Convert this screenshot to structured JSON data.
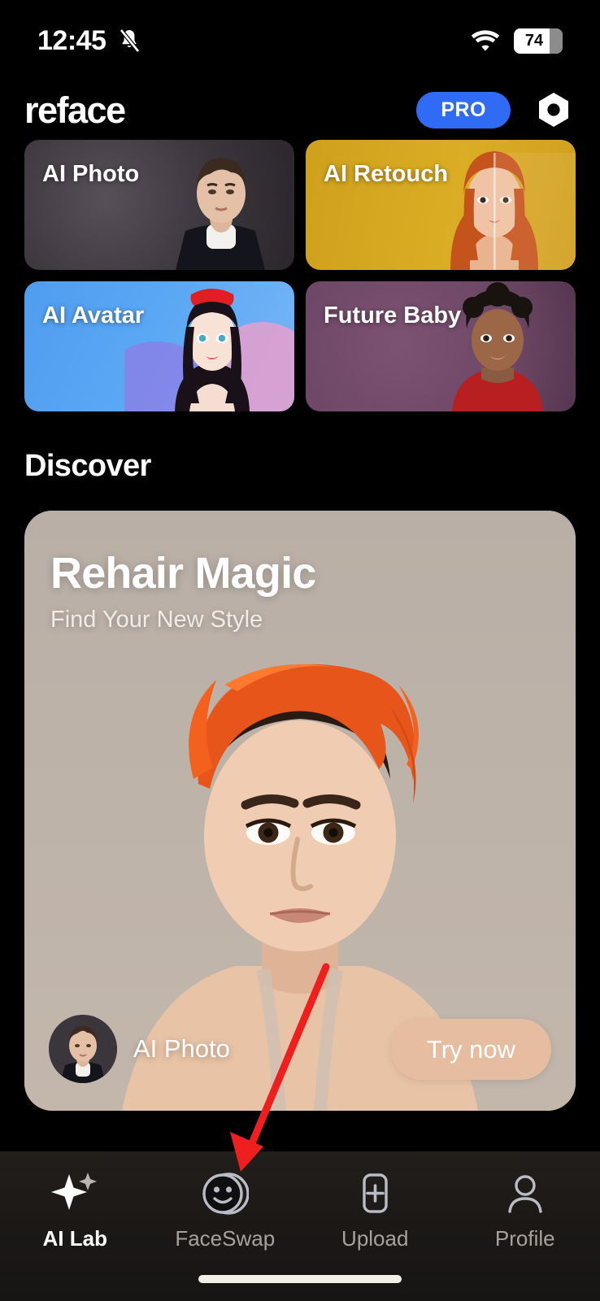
{
  "status_bar": {
    "time": "12:45",
    "bell_icon": "bell-muted-icon",
    "wifi_icon": "wifi-icon",
    "battery_level": "74",
    "battery_percent": 74
  },
  "header": {
    "logo": "reface",
    "pro_label": "PRO",
    "settings_icon": "hexagon-settings-icon"
  },
  "feature_cards": [
    {
      "label": "AI Photo",
      "color": "#3b353c",
      "name": "card-ai-photo"
    },
    {
      "label": "AI Retouch",
      "color": "#d4a820",
      "name": "card-ai-retouch"
    },
    {
      "label": "AI Avatar",
      "color": "#4f9df0",
      "name": "card-ai-avatar"
    },
    {
      "label": "Future Baby",
      "color": "#6d4765",
      "name": "card-future-baby"
    }
  ],
  "discover": {
    "heading": "Discover",
    "featured": {
      "title": "Rehair Magic",
      "subtitle": "Find Your New Style",
      "author": "AI Photo",
      "cta_label": "Try now",
      "cta_color": "#e7bda2",
      "card_color": "#b7ada3"
    }
  },
  "bottom_nav": {
    "items": [
      {
        "label": "AI Lab",
        "icon": "sparkle-icon",
        "active": true
      },
      {
        "label": "FaceSwap",
        "icon": "smiley-face-icon",
        "active": false
      },
      {
        "label": "Upload",
        "icon": "plus-square-icon",
        "active": false
      },
      {
        "label": "Profile",
        "icon": "person-icon",
        "active": false
      }
    ]
  },
  "annotation": {
    "type": "red-arrow",
    "color": "#f01f1f",
    "points_to": "FaceSwap"
  }
}
